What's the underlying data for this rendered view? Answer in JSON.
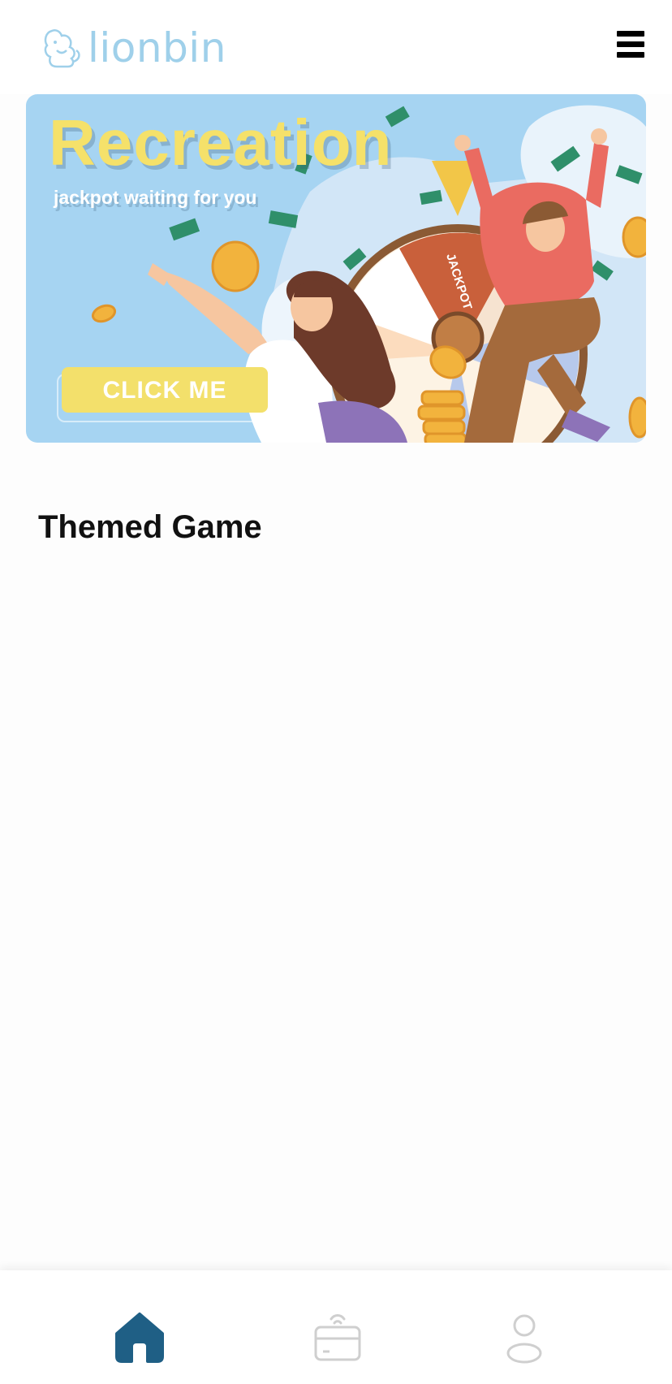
{
  "header": {
    "brand": "lionbin",
    "logo_icon": "lion-logo-icon",
    "menu_icon": "hamburger-menu-icon",
    "brand_color": "#9fd0ea"
  },
  "banner": {
    "title": "Recreation",
    "subtitle": "jackpot waiting for you",
    "button_label": "CLICK ME",
    "wheel_label": "JACKPOT",
    "title_color": "#f5e16a",
    "background_color": "#a6d4f2"
  },
  "main": {
    "section_title": "Themed Game"
  },
  "bottom_nav": {
    "items": [
      {
        "icon": "home-icon",
        "active": true,
        "color": "#1f5f85"
      },
      {
        "icon": "wallet-icon",
        "active": false,
        "color": "#cfcfcf"
      },
      {
        "icon": "user-icon",
        "active": false,
        "color": "#cfcfcf"
      }
    ]
  }
}
